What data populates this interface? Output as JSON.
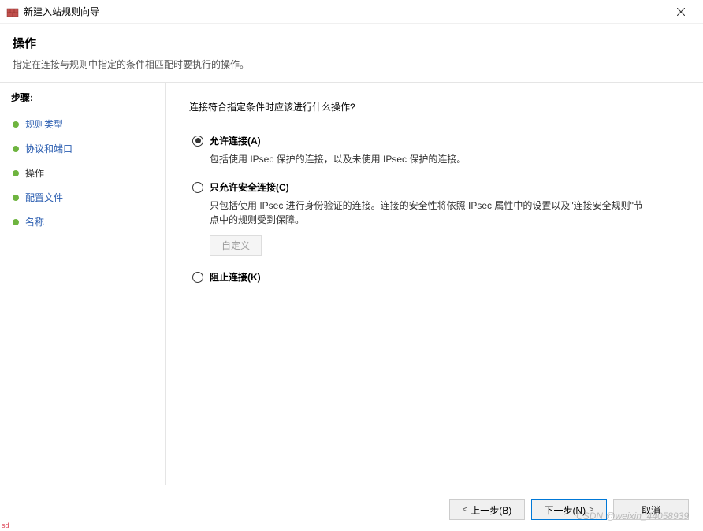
{
  "window": {
    "title": "新建入站规则向导",
    "close_label": "Close"
  },
  "header": {
    "title": "操作",
    "subtitle": "指定在连接与规则中指定的条件相匹配时要执行的操作。"
  },
  "sidebar": {
    "title": "步骤:",
    "items": [
      {
        "label": "规则类型",
        "current": false
      },
      {
        "label": "协议和端口",
        "current": false
      },
      {
        "label": "操作",
        "current": true
      },
      {
        "label": "配置文件",
        "current": false
      },
      {
        "label": "名称",
        "current": false
      }
    ]
  },
  "main": {
    "question": "连接符合指定条件时应该进行什么操作?",
    "options": [
      {
        "id": "allow",
        "label": "允许连接(A)",
        "selected": true,
        "description": "包括使用 IPsec 保护的连接，以及未使用 IPsec 保护的连接。"
      },
      {
        "id": "allow-secure",
        "label": "只允许安全连接(C)",
        "selected": false,
        "description": "只包括使用 IPsec 进行身份验证的连接。连接的安全性将依照 IPsec 属性中的设置以及\"连接安全规则\"节点中的规则受到保障。",
        "customize_label": "自定义"
      },
      {
        "id": "block",
        "label": "阻止连接(K)",
        "selected": false
      }
    ]
  },
  "footer": {
    "back": "上一步(B)",
    "next": "下一步(N)",
    "cancel": "取消"
  },
  "watermark": "CSDN @weixin_44058939",
  "corner": "sd"
}
